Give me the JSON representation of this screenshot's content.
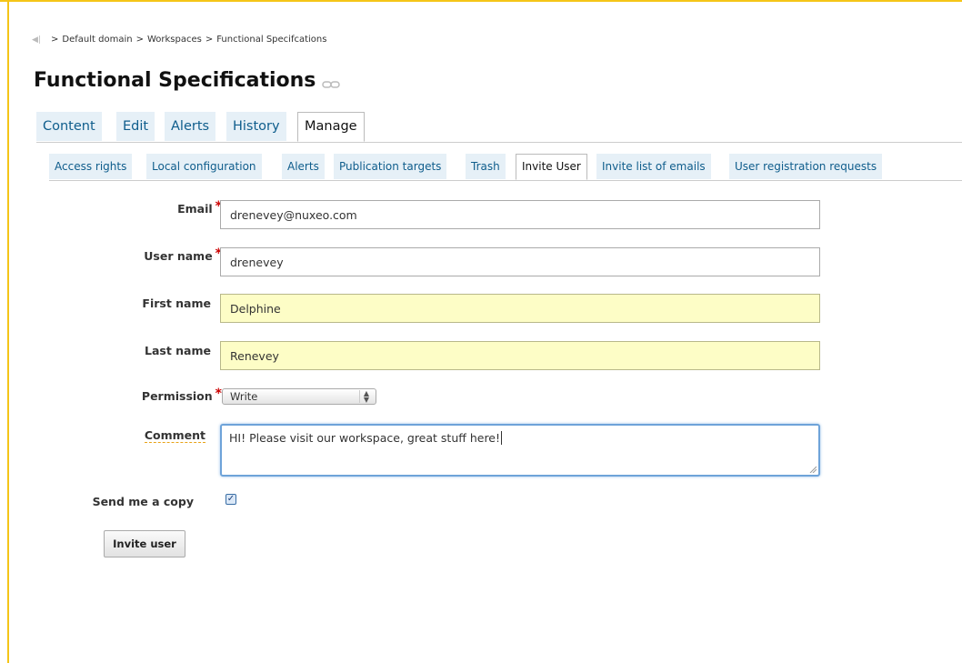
{
  "breadcrumb": {
    "separator": ">",
    "items": [
      "Default domain",
      "Workspaces",
      "Functional Specifcations"
    ]
  },
  "page": {
    "title": "Functional Specifications"
  },
  "main_tabs": [
    {
      "label": "Content",
      "active": false
    },
    {
      "label": "Edit",
      "active": false
    },
    {
      "label": "Alerts",
      "active": false
    },
    {
      "label": "History",
      "active": false
    },
    {
      "label": "Manage",
      "active": true
    }
  ],
  "sub_tabs": [
    {
      "label": "Access rights",
      "active": false
    },
    {
      "label": "Local configuration",
      "active": false
    },
    {
      "label": "Alerts",
      "active": false
    },
    {
      "label": "Publication targets",
      "active": false
    },
    {
      "label": "Trash",
      "active": false
    },
    {
      "label": "Invite User",
      "active": true
    },
    {
      "label": "Invite list of emails",
      "active": false
    },
    {
      "label": "User registration requests",
      "active": false
    }
  ],
  "form": {
    "required_marker": "*",
    "email": {
      "label": "Email",
      "value": "drenevey@nuxeo.com"
    },
    "username": {
      "label": "User name",
      "value": "drenevey"
    },
    "firstname": {
      "label": "First name",
      "value": "Delphine"
    },
    "lastname": {
      "label": "Last name",
      "value": "Renevey"
    },
    "permission": {
      "label": "Permission",
      "selected": "Write"
    },
    "comment": {
      "label": "Comment",
      "value": "HI! Please visit our workspace, great stuff here!"
    },
    "send_copy": {
      "label": "Send me a copy",
      "checked": true
    },
    "submit_label": "Invite user"
  },
  "colors": {
    "frame": "#f5c518",
    "tab_bg": "#e6f0f7",
    "tab_text": "#0f5d8c",
    "autofill_bg": "#fdfdc6",
    "required": "#cc0000",
    "focus": "#6ea3d9"
  }
}
